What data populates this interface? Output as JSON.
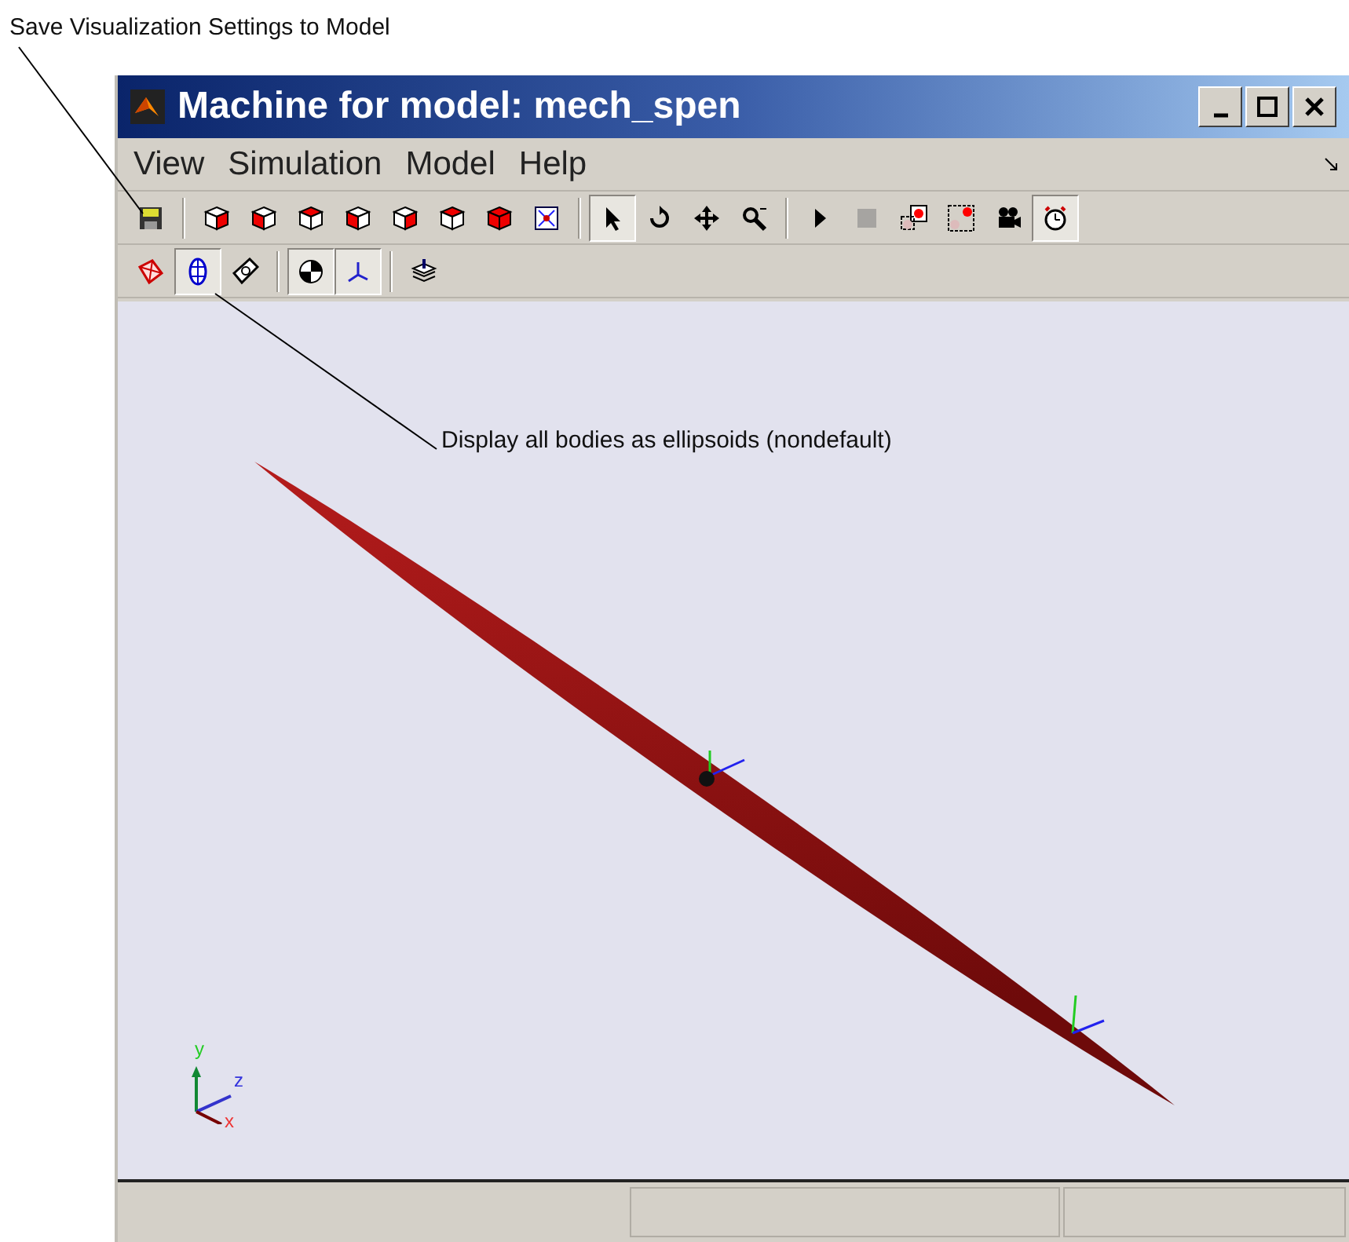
{
  "callouts": [
    {
      "text": "Save Visualization Settings to Model"
    },
    {
      "text": "Display all bodies as ellipsoids (nondefault)"
    }
  ],
  "window": {
    "title": "Machine for model: mech_spen"
  },
  "menu": [
    {
      "label": "View"
    },
    {
      "label": "Simulation"
    },
    {
      "label": "Model"
    },
    {
      "label": "Help"
    }
  ],
  "toolbar1": [
    [
      {
        "kind": "save",
        "selected": false
      }
    ],
    [
      {
        "kind": "cube-right",
        "selected": false
      },
      {
        "kind": "cube-left",
        "selected": false
      },
      {
        "kind": "cube-top",
        "selected": false
      },
      {
        "kind": "cube-bottom",
        "selected": false
      },
      {
        "kind": "cube-front",
        "selected": false
      },
      {
        "kind": "cube-back",
        "selected": false
      },
      {
        "kind": "cube-solid",
        "selected": false
      },
      {
        "kind": "fit",
        "selected": false
      }
    ],
    [
      {
        "kind": "pointer",
        "selected": true
      },
      {
        "kind": "rotate",
        "selected": false
      },
      {
        "kind": "pan",
        "selected": false
      },
      {
        "kind": "zoom",
        "selected": false
      }
    ],
    [
      {
        "kind": "play",
        "selected": false
      },
      {
        "kind": "stop",
        "selected": false,
        "disabled": true
      },
      {
        "kind": "record-a",
        "selected": false
      },
      {
        "kind": "record-b",
        "selected": false
      },
      {
        "kind": "camera",
        "selected": false
      },
      {
        "kind": "timer",
        "selected": true
      }
    ]
  ],
  "toolbar2": [
    [
      {
        "kind": "hull",
        "selected": false
      },
      {
        "kind": "ellipsoid",
        "selected": true
      },
      {
        "kind": "body",
        "selected": false
      }
    ],
    [
      {
        "kind": "cg",
        "selected": true
      },
      {
        "kind": "frames",
        "selected": true
      }
    ],
    [
      {
        "kind": "layers",
        "selected": false
      }
    ]
  ],
  "axes_triad": {
    "y": "y",
    "z": "z",
    "x": "x"
  }
}
